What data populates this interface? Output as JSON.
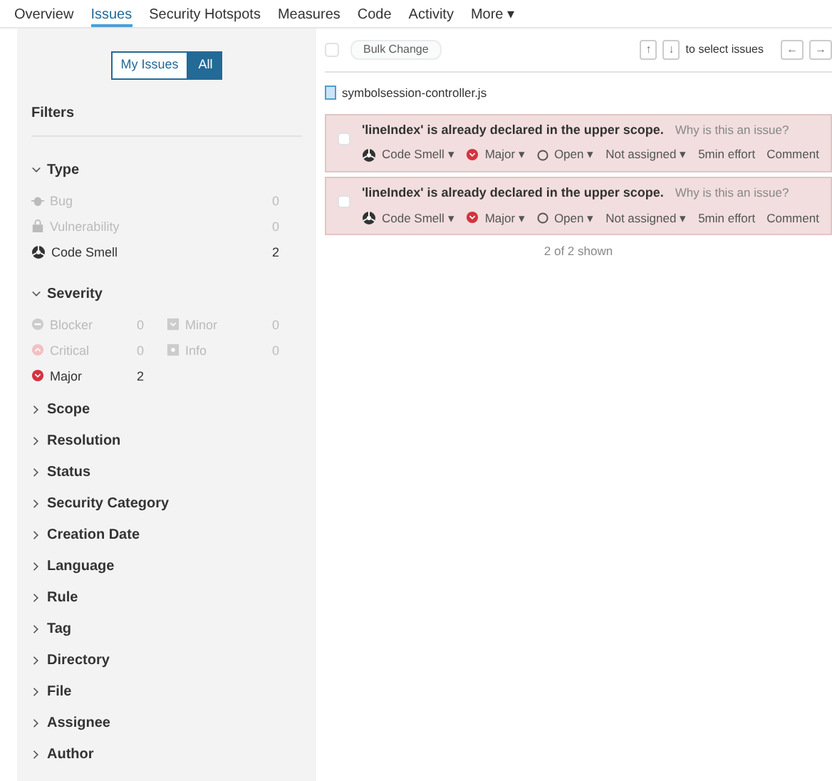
{
  "nav": [
    {
      "label": "Overview",
      "selected": false
    },
    {
      "label": "Issues",
      "selected": true
    },
    {
      "label": "Security Hotspots",
      "selected": false
    },
    {
      "label": "Measures",
      "selected": false
    },
    {
      "label": "Code",
      "selected": false
    },
    {
      "label": "Activity",
      "selected": false
    },
    {
      "label": "More ▾",
      "selected": false
    }
  ],
  "scope_toggle": [
    {
      "label": "My Issues",
      "selected": false
    },
    {
      "label": "All",
      "selected": true
    }
  ],
  "filters_title": "Filters",
  "type_facet": {
    "title": "Type",
    "expanded": true,
    "items": [
      {
        "kind": "bug",
        "label": "Bug",
        "count": "0",
        "disabled": true
      },
      {
        "kind": "vulnerability",
        "label": "Vulnerability",
        "count": "0",
        "disabled": true
      },
      {
        "kind": "smell",
        "label": "Code Smell",
        "count": "2",
        "disabled": false
      }
    ]
  },
  "severity_facet": {
    "title": "Severity",
    "expanded": true,
    "items": [
      {
        "kind": "blocker",
        "label": "Blocker",
        "count": "0",
        "disabled": true
      },
      {
        "kind": "minor",
        "label": "Minor",
        "count": "0",
        "disabled": true
      },
      {
        "kind": "critical",
        "label": "Critical",
        "count": "0",
        "disabled": true
      },
      {
        "kind": "info",
        "label": "Info",
        "count": "0",
        "disabled": true
      },
      {
        "kind": "major",
        "label": "Major",
        "count": "2",
        "disabled": false
      }
    ]
  },
  "facets": [
    {
      "title": "Scope",
      "expanded": false
    },
    {
      "title": "Resolution",
      "expanded": false
    },
    {
      "title": "Status",
      "expanded": false
    },
    {
      "title": "Security Category",
      "expanded": false
    },
    {
      "title": "Creation Date",
      "expanded": false
    },
    {
      "title": "Language",
      "expanded": false
    },
    {
      "title": "Rule",
      "expanded": false
    },
    {
      "title": "Tag",
      "expanded": false
    },
    {
      "title": "Directory",
      "expanded": false
    },
    {
      "title": "File",
      "expanded": false
    },
    {
      "title": "Assignee",
      "expanded": false
    },
    {
      "title": "Author",
      "expanded": false
    }
  ],
  "toolbar": {
    "select_all_checked": false,
    "bulk_change": "Bulk Change",
    "select_keys": [
      "↑",
      "↓"
    ],
    "select_hint": "to select issues",
    "navigate_keys": [
      "←",
      "→"
    ]
  },
  "file": "symbolsession-controller.js",
  "issues": [
    {
      "checked": false,
      "message": "'lineIndex' is already declared in the upper scope.",
      "why": "Why is this an issue?",
      "type": "Code Smell ▾",
      "severity": "Major ▾",
      "status": "Open ▾",
      "assignee": "Not assigned ▾",
      "effort": "5min effort",
      "comment": "Comment"
    },
    {
      "checked": false,
      "message": "'lineIndex' is already declared in the upper scope.",
      "why": "Why is this an issue?",
      "type": "Code Smell ▾",
      "severity": "Major ▾",
      "status": "Open ▾",
      "assignee": "Not assigned ▾",
      "effort": "5min effort",
      "comment": "Comment"
    }
  ],
  "shown": "2 of 2 shown"
}
